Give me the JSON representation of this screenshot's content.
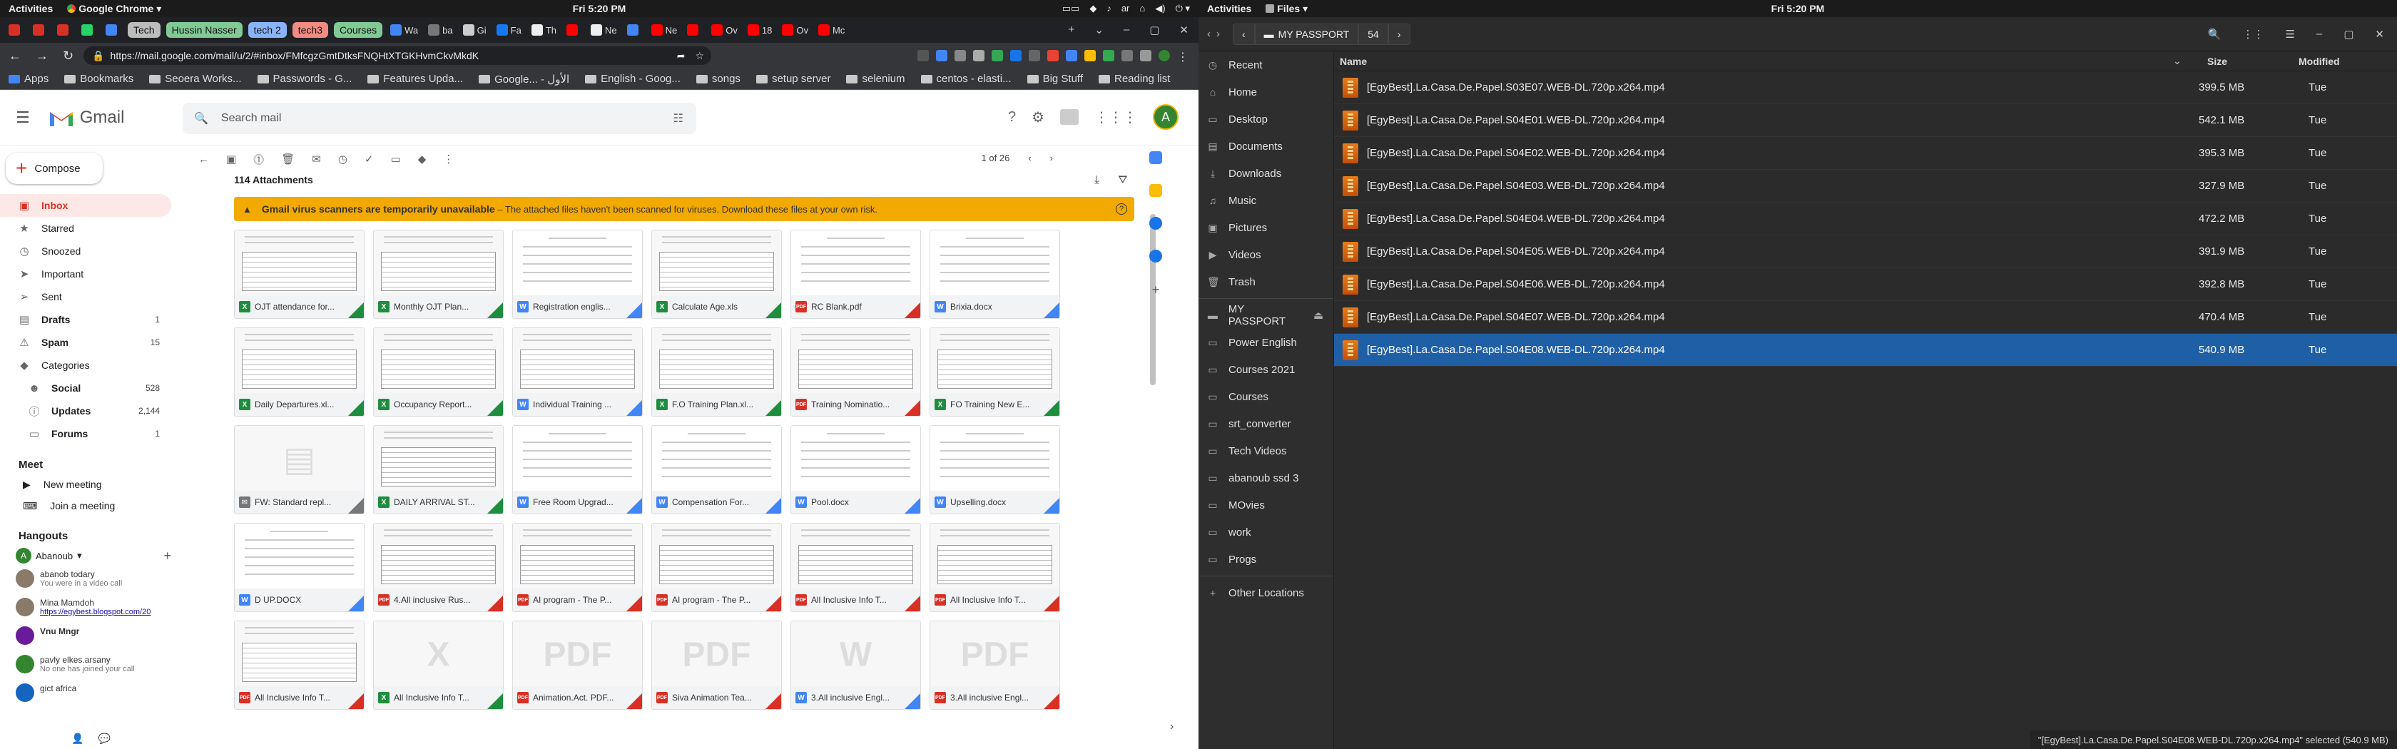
{
  "left_screen": {
    "topbar": {
      "activities": "Activities",
      "app": "Google Chrome",
      "clock": "Fri  5:20 PM",
      "lang": "ar"
    },
    "tabs": [
      {
        "label": "",
        "color": "#d93025"
      },
      {
        "label": "",
        "color": "#d93025"
      },
      {
        "label": "",
        "color": "#d93025"
      },
      {
        "label": "",
        "color": "#25d366"
      },
      {
        "label": "",
        "color": "#4285f4"
      },
      {
        "group": "Tech",
        "color": "#bdbdbd"
      },
      {
        "group": "Hussin Nasser",
        "color": "#81c995"
      },
      {
        "group": "tech 2",
        "color": "#8ab4f8"
      },
      {
        "group": "tech3",
        "color": "#f28b82"
      },
      {
        "group": "Courses",
        "color": "#81c995"
      },
      {
        "label": "Wa",
        "color": "#4285f4"
      },
      {
        "label": "ba",
        "color": "#777777"
      },
      {
        "label": "Gi",
        "color": "#cccccc"
      },
      {
        "label": "Fa",
        "color": "#1877f2"
      },
      {
        "label": "Th",
        "color": "#eeeeee"
      },
      {
        "label": "",
        "color": "#ff0000"
      },
      {
        "label": "Ne",
        "color": "#eeeeee"
      },
      {
        "label": "",
        "color": "#4285f4"
      },
      {
        "label": "Ne",
        "color": "#ff0000"
      },
      {
        "label": "",
        "color": "#ff0000"
      },
      {
        "label": "Ov",
        "color": "#ff0000"
      },
      {
        "label": "18",
        "color": "#ff0000"
      },
      {
        "label": "Ov",
        "color": "#ff0000"
      },
      {
        "label": "Mc",
        "color": "#ff0000"
      }
    ],
    "url": "https://mail.google.com/mail/u/2/#inbox/FMfcgzGmtDtksFNQHtXTGKHvmCkvMkdK",
    "bookmarks": [
      "Apps",
      "Bookmarks",
      "Seoera Works...",
      "Passwords - G...",
      "Features Upda...",
      "Google... - الأول",
      "English - Goog...",
      "songs",
      "setup server",
      "selenium",
      "centos - elasti...",
      "Big Stuff"
    ],
    "reading_list": "Reading list"
  },
  "gmail": {
    "logo": "Gmail",
    "search_placeholder": "Search mail",
    "compose": "Compose",
    "avatar_letter": "A",
    "nav": [
      {
        "label": "Inbox",
        "icon": "inbox-icon",
        "glyph": "▣",
        "count": ""
      },
      {
        "label": "Starred",
        "icon": "star-icon",
        "glyph": "★",
        "count": ""
      },
      {
        "label": "Snoozed",
        "icon": "clock-icon",
        "glyph": "◷",
        "count": ""
      },
      {
        "label": "Important",
        "icon": "important-icon",
        "glyph": "➤",
        "count": ""
      },
      {
        "label": "Sent",
        "icon": "send-icon",
        "glyph": "➢",
        "count": ""
      },
      {
        "label": "Drafts",
        "icon": "draft-icon",
        "glyph": "▤",
        "count": "1"
      },
      {
        "label": "Spam",
        "icon": "spam-icon",
        "glyph": "⚠",
        "count": "15"
      },
      {
        "label": "Categories",
        "icon": "label-icon",
        "glyph": "◆",
        "count": ""
      },
      {
        "label": "Social",
        "icon": "people-icon",
        "glyph": "☻",
        "count": "528"
      },
      {
        "label": "Updates",
        "icon": "info-icon",
        "glyph": "ⓘ",
        "count": "2,144"
      },
      {
        "label": "Forums",
        "icon": "forum-icon",
        "glyph": "▭",
        "count": "1"
      }
    ],
    "meet": {
      "title": "Meet",
      "new_meeting": "New meeting",
      "join": "Join a meeting"
    },
    "hangouts": {
      "title": "Hangouts",
      "user": "Abanoub",
      "contacts": [
        {
          "name": "abanob todary",
          "status": "You were in a video call",
          "link": false
        },
        {
          "name": "Mina Mamdoh",
          "status": "https://egybest.blogspot.com/20",
          "link": true
        },
        {
          "name": "Vnu Mngr",
          "status": "",
          "link": false
        },
        {
          "name": "pavly elkes.arsany",
          "status": "No one has joined your call",
          "link": false
        },
        {
          "name": "gict africa",
          "status": "",
          "link": false
        }
      ]
    },
    "pagination": "1 of 26",
    "attachments_count": "114 Attachments",
    "warning": {
      "bold": "Gmail virus scanners are temporarily unavailable",
      "text": " – The attached files haven't been scanned for viruses. Download these files at your own risk."
    },
    "attachments": [
      {
        "name": "OJT attendance for...",
        "type": "X",
        "color": "#1e8e3e",
        "thumb": "table"
      },
      {
        "name": "Monthly OJT Plan...",
        "type": "X",
        "color": "#1e8e3e",
        "thumb": "table"
      },
      {
        "name": "Registration englis...",
        "type": "W",
        "color": "#4285f4",
        "thumb": "doc"
      },
      {
        "name": "Calculate Age.xls",
        "type": "X",
        "color": "#1e8e3e",
        "thumb": "table"
      },
      {
        "name": "RC Blank.pdf",
        "type": "PDF",
        "color": "#d93025",
        "thumb": "doc"
      },
      {
        "name": "Brixia.docx",
        "type": "W",
        "color": "#4285f4",
        "thumb": "doc"
      },
      {
        "name": "Daily Departures.xl...",
        "type": "X",
        "color": "#1e8e3e",
        "thumb": "table"
      },
      {
        "name": "Occupancy Report...",
        "type": "X",
        "color": "#1e8e3e",
        "thumb": "table"
      },
      {
        "name": "Individual Training ...",
        "type": "W",
        "color": "#4285f4",
        "thumb": "table"
      },
      {
        "name": "F.O Training Plan.xl...",
        "type": "X",
        "color": "#1e8e3e",
        "thumb": "table"
      },
      {
        "name": "Training Nominatio...",
        "type": "PDF",
        "color": "#d93025",
        "thumb": "table"
      },
      {
        "name": "FO Training New E...",
        "type": "X",
        "color": "#1e8e3e",
        "thumb": "table"
      },
      {
        "name": "FW: Standard repl...",
        "type": "✉",
        "color": "#777777",
        "thumb": "blank"
      },
      {
        "name": "DAILY ARRIVAL ST...",
        "type": "X",
        "color": "#1e8e3e",
        "thumb": "table"
      },
      {
        "name": "Free Room Upgrad...",
        "type": "W",
        "color": "#4285f4",
        "thumb": "doc"
      },
      {
        "name": "Compensation For...",
        "type": "W",
        "color": "#4285f4",
        "thumb": "doc"
      },
      {
        "name": "Pool.docx",
        "type": "W",
        "color": "#4285f4",
        "thumb": "doc"
      },
      {
        "name": "Upselling.docx",
        "type": "W",
        "color": "#4285f4",
        "thumb": "doc"
      },
      {
        "name": "D UP.DOCX",
        "type": "W",
        "color": "#4285f4",
        "thumb": "doc"
      },
      {
        "name": "4.All inclusive Rus...",
        "type": "PDF",
        "color": "#d93025",
        "thumb": "table"
      },
      {
        "name": "AI program - The P...",
        "type": "PDF",
        "color": "#d93025",
        "thumb": "table"
      },
      {
        "name": "AI program - The P...",
        "type": "PDF",
        "color": "#d93025",
        "thumb": "table"
      },
      {
        "name": "All Inclusive Info T...",
        "type": "PDF",
        "color": "#d93025",
        "thumb": "table"
      },
      {
        "name": "All Inclusive Info T...",
        "type": "PDF",
        "color": "#d93025",
        "thumb": "table"
      },
      {
        "name": "All Inclusive Info T...",
        "type": "PDF",
        "color": "#d93025",
        "thumb": "table"
      },
      {
        "name": "All Inclusive Info T...",
        "type": "X",
        "color": "#1e8e3e",
        "thumb": "big",
        "big": "X"
      },
      {
        "name": "Animation.Act. PDF...",
        "type": "PDF",
        "color": "#d93025",
        "thumb": "big",
        "big": "PDF"
      },
      {
        "name": "Siva Animation Tea...",
        "type": "PDF",
        "color": "#d93025",
        "thumb": "big",
        "big": "PDF"
      },
      {
        "name": "3.All inclusive Engl...",
        "type": "W",
        "color": "#4285f4",
        "thumb": "big",
        "big": "W"
      },
      {
        "name": "3.All inclusive Engl...",
        "type": "PDF",
        "color": "#d93025",
        "thumb": "big",
        "big": "PDF"
      }
    ]
  },
  "right_screen": {
    "topbar": {
      "activities": "Activities",
      "app": "Files",
      "clock": "Fri  5:20 PM"
    },
    "breadcrumbs": [
      "MY PASSPORT",
      "54"
    ],
    "sidebar": [
      {
        "label": "Recent",
        "glyph": "◷",
        "icon": "recent-icon"
      },
      {
        "label": "Home",
        "glyph": "⌂",
        "icon": "home-icon"
      },
      {
        "label": "Desktop",
        "glyph": "▭",
        "icon": "desktop-icon"
      },
      {
        "label": "Documents",
        "glyph": "▤",
        "icon": "documents-icon"
      },
      {
        "label": "Downloads",
        "glyph": "⤓",
        "icon": "downloads-icon"
      },
      {
        "label": "Music",
        "glyph": "♫",
        "icon": "music-icon"
      },
      {
        "label": "Pictures",
        "glyph": "▣",
        "icon": "pictures-icon"
      },
      {
        "label": "Videos",
        "glyph": "▶",
        "icon": "videos-icon"
      },
      {
        "label": "Trash",
        "glyph": "🗑",
        "icon": "trash-icon"
      },
      {
        "label": "MY PASSPORT",
        "glyph": "▬",
        "icon": "drive-icon",
        "eject": true
      },
      {
        "label": "Power English",
        "glyph": "▭",
        "icon": "folder-icon"
      },
      {
        "label": "Courses 2021",
        "glyph": "▭",
        "icon": "folder-icon"
      },
      {
        "label": "Courses",
        "glyph": "▭",
        "icon": "folder-icon"
      },
      {
        "label": "srt_converter",
        "glyph": "▭",
        "icon": "folder-icon"
      },
      {
        "label": "Tech Videos",
        "glyph": "▭",
        "icon": "folder-icon"
      },
      {
        "label": "abanoub ssd 3",
        "glyph": "▭",
        "icon": "folder-icon"
      },
      {
        "label": "MOvies",
        "glyph": "▭",
        "icon": "folder-icon"
      },
      {
        "label": "work",
        "glyph": "▭",
        "icon": "folder-icon"
      },
      {
        "label": "Progs",
        "glyph": "▭",
        "icon": "folder-icon"
      },
      {
        "label": "Other Locations",
        "glyph": "+",
        "icon": "plus-icon"
      }
    ],
    "columns": {
      "name": "Name",
      "size": "Size",
      "modified": "Modified"
    },
    "files": [
      {
        "name": "[EgyBest].La.Casa.De.Papel.S03E07.WEB-DL.720p.x264.mp4",
        "size": "399.5 MB",
        "modified": "Tue"
      },
      {
        "name": "[EgyBest].La.Casa.De.Papel.S04E01.WEB-DL.720p.x264.mp4",
        "size": "542.1 MB",
        "modified": "Tue"
      },
      {
        "name": "[EgyBest].La.Casa.De.Papel.S04E02.WEB-DL.720p.x264.mp4",
        "size": "395.3 MB",
        "modified": "Tue"
      },
      {
        "name": "[EgyBest].La.Casa.De.Papel.S04E03.WEB-DL.720p.x264.mp4",
        "size": "327.9 MB",
        "modified": "Tue"
      },
      {
        "name": "[EgyBest].La.Casa.De.Papel.S04E04.WEB-DL.720p.x264.mp4",
        "size": "472.2 MB",
        "modified": "Tue"
      },
      {
        "name": "[EgyBest].La.Casa.De.Papel.S04E05.WEB-DL.720p.x264.mp4",
        "size": "391.9 MB",
        "modified": "Tue"
      },
      {
        "name": "[EgyBest].La.Casa.De.Papel.S04E06.WEB-DL.720p.x264.mp4",
        "size": "392.8 MB",
        "modified": "Tue"
      },
      {
        "name": "[EgyBest].La.Casa.De.Papel.S04E07.WEB-DL.720p.x264.mp4",
        "size": "470.4 MB",
        "modified": "Tue"
      },
      {
        "name": "[EgyBest].La.Casa.De.Papel.S04E08.WEB-DL.720p.x264.mp4",
        "size": "540.9 MB",
        "modified": "Tue",
        "selected": true
      }
    ],
    "status": "\"[EgyBest].La.Casa.De.Papel.S04E08.WEB-DL.720p.x264.mp4\" selected (540.9 MB)"
  }
}
